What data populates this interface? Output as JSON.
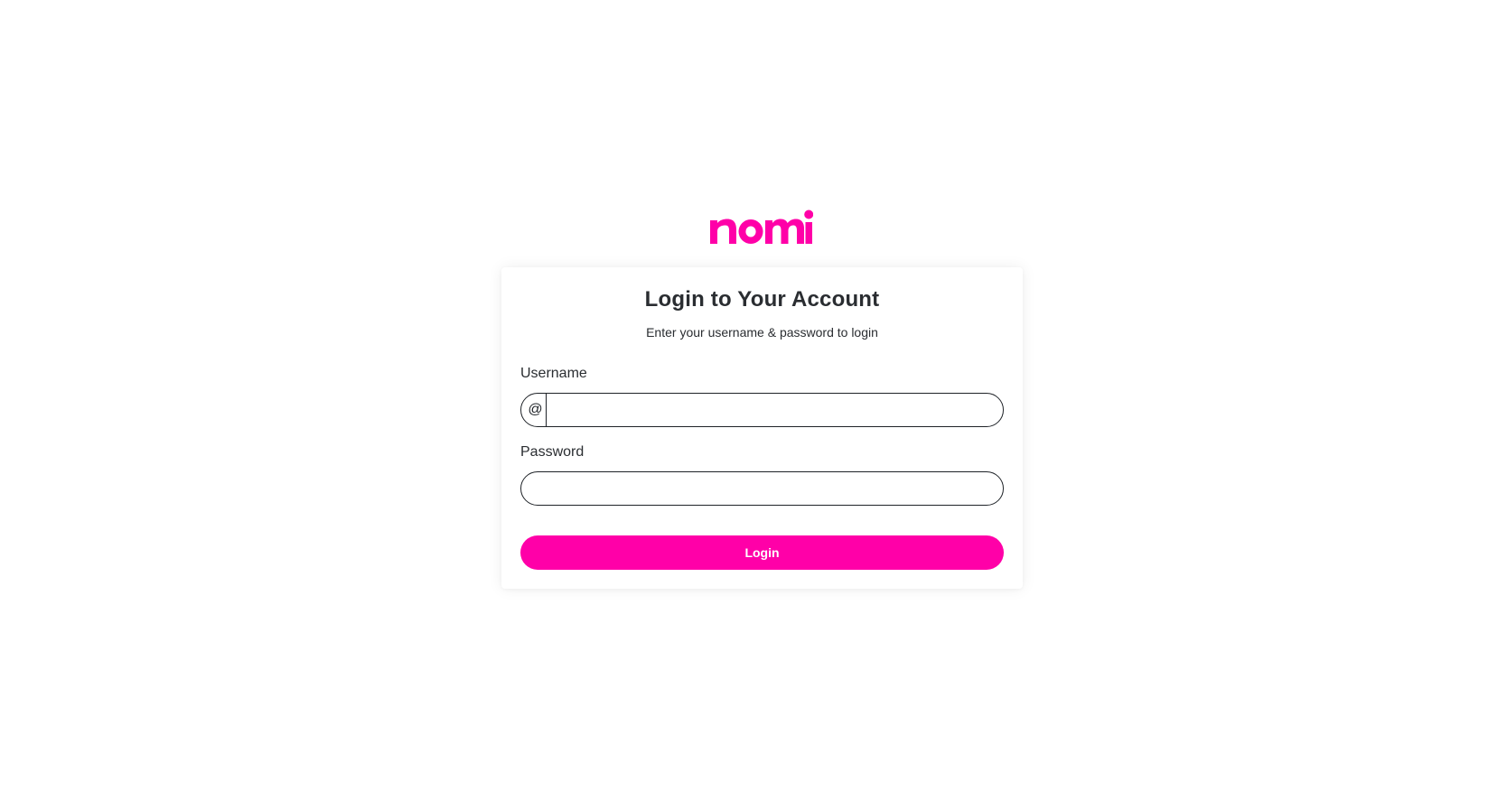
{
  "brand": {
    "logo_text": "nomi",
    "color": "#ff00a8"
  },
  "login_form": {
    "title": "Login to Your Account",
    "subtitle": "Enter your username & password to login",
    "username": {
      "label": "Username",
      "prefix": "@",
      "value": "",
      "placeholder": ""
    },
    "password": {
      "label": "Password",
      "value": "",
      "placeholder": ""
    },
    "submit_label": "Login"
  }
}
